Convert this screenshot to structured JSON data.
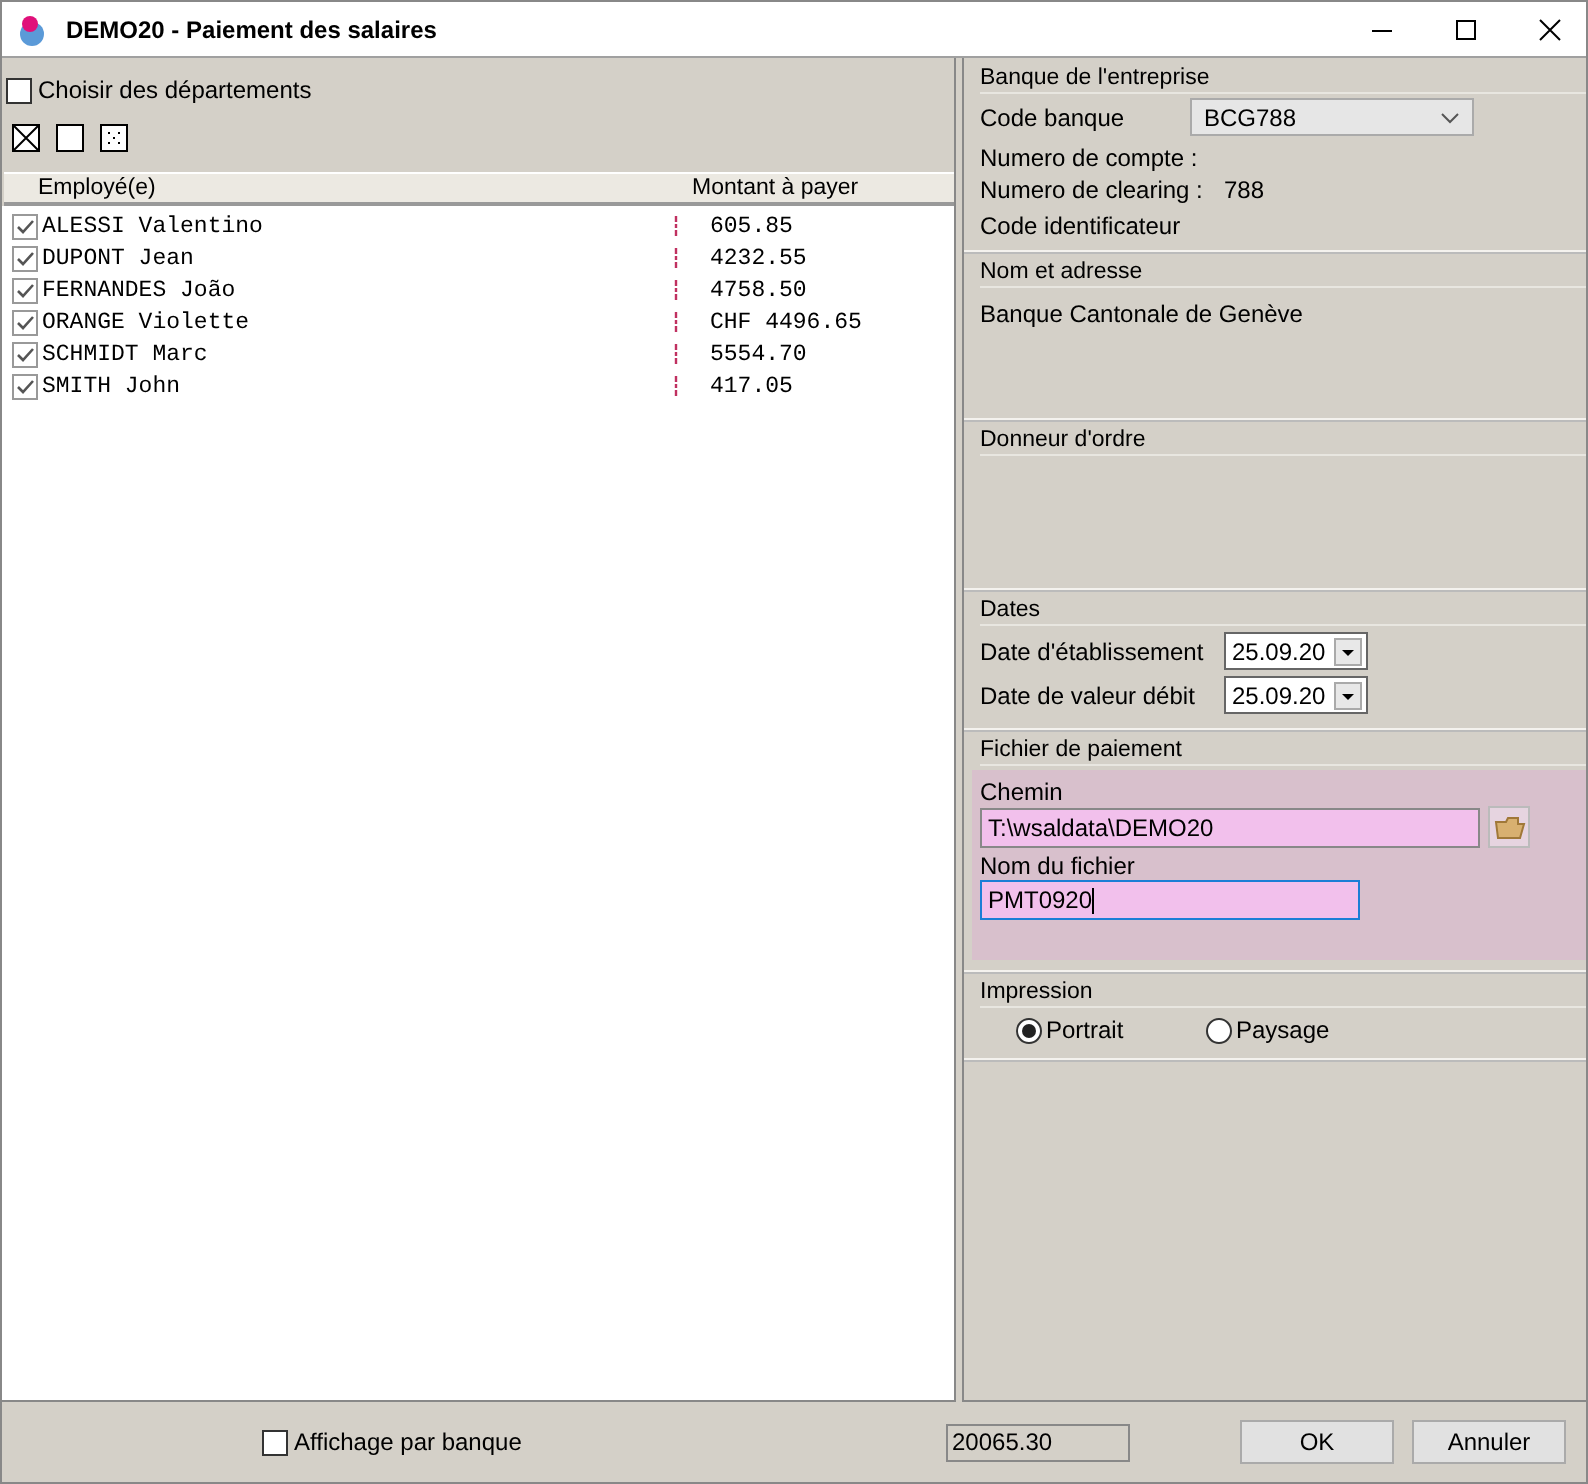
{
  "window": {
    "title": "DEMO20 - Paiement des salaires"
  },
  "choose_departments": {
    "label": "Choisir des départements",
    "checked": false
  },
  "selection_buttons": [
    {
      "kind": "check-all"
    },
    {
      "kind": "uncheck-all"
    },
    {
      "kind": "invert"
    }
  ],
  "table": {
    "columns": [
      "Employé(e)",
      "Montant à payer"
    ],
    "rows": [
      {
        "employee": "ALESSI Valentino",
        "amount": "605.85",
        "checked": true
      },
      {
        "employee": "DUPONT Jean",
        "amount": "4232.55",
        "checked": true
      },
      {
        "employee": "FERNANDES João",
        "amount": "4758.50",
        "checked": true
      },
      {
        "employee": "ORANGE Violette",
        "amount": "CHF 4496.65",
        "checked": true
      },
      {
        "employee": "SCHMIDT Marc",
        "amount": "5554.70",
        "checked": true
      },
      {
        "employee": "SMITH John",
        "amount": "417.05",
        "checked": true
      }
    ]
  },
  "bank": {
    "heading": "Banque de l'entreprise",
    "code_label": "Code banque",
    "code_value": "BCG788",
    "account_label": "Numero de compte :",
    "clearing_label": "Numero de clearing :",
    "clearing_value": "788",
    "identifier_label": "Code identificateur"
  },
  "name_address": {
    "heading": "Nom et adresse",
    "text": "Banque Cantonale de Genève"
  },
  "ordering_party": {
    "heading": "Donneur d'ordre"
  },
  "dates": {
    "heading": "Dates",
    "fields": [
      {
        "label": "Date d'établissement",
        "value": "25.09.20"
      },
      {
        "label": "Date de valeur débit",
        "value": "25.09.20"
      }
    ]
  },
  "payment_file": {
    "heading": "Fichier de paiement",
    "path_label": "Chemin",
    "path_value": "T:\\wsaldata\\DEMO20",
    "file_label": "Nom du fichier",
    "file_value": "PMT0920"
  },
  "printing": {
    "heading": "Impression",
    "options": [
      {
        "label": "Portrait",
        "selected": true
      },
      {
        "label": "Paysage",
        "selected": false
      }
    ]
  },
  "footer": {
    "by_bank": {
      "label": "Affichage par banque",
      "checked": false
    },
    "total": "20065.30",
    "buttons": [
      "OK",
      "Annuler"
    ]
  }
}
